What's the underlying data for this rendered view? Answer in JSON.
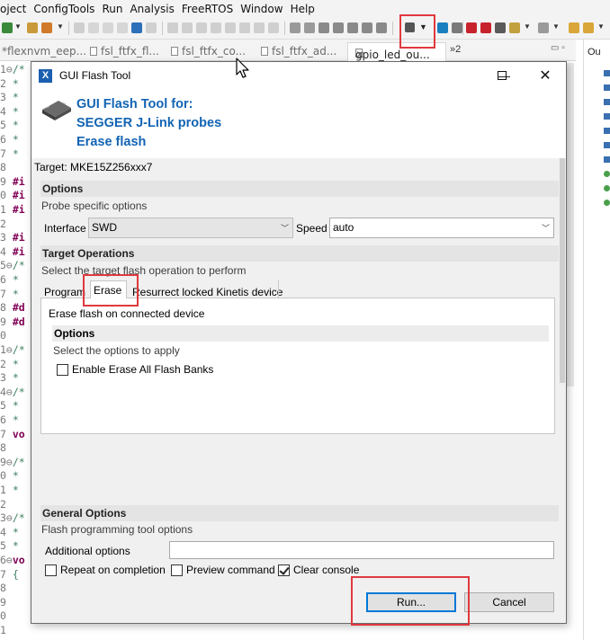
{
  "ide": {
    "menu": [
      "oject",
      "ConfigTools",
      "Run",
      "Analysis",
      "FreeRTOS",
      "Window",
      "Help"
    ],
    "editor_tabs": [
      "*flexnvm_eep...",
      "fsl_ftfx_fl...",
      "fsl_ftfx_co...",
      "fsl_ftfx_ad...",
      "gpio_led_ou..."
    ],
    "tab_close": "✕",
    "tab_overflow": "»2",
    "view_controls": "▭ ▫",
    "right_panel_tab": "Ou",
    "line_numbers": [
      "1",
      "2",
      "3",
      "4",
      "5",
      "6",
      "7",
      "8",
      "9",
      "0",
      "1",
      "2",
      "3",
      "4",
      "5",
      "6",
      "7",
      "8",
      "9",
      "0",
      "1",
      "2",
      "3",
      "4",
      "5",
      "6",
      "7",
      "8",
      "9",
      "0",
      "1",
      "2",
      "3",
      "4",
      "5",
      "6",
      "7",
      "8",
      "9",
      "0",
      "1"
    ],
    "line_snippets": [
      "/*",
      "*",
      "*",
      "*",
      "*",
      "*",
      "*",
      "",
      "#i",
      "#i",
      "#i",
      "",
      "#i",
      "#i",
      "/*",
      "*",
      "*",
      "#d",
      "#d",
      "",
      "/*",
      "*",
      "*",
      "/*",
      "*",
      "*",
      "vo",
      "",
      "/*",
      "*",
      "*",
      "",
      "/*",
      "*",
      "*",
      "vo",
      "{",
      "",
      "",
      "",
      ""
    ],
    "fold_lines": [
      0,
      14,
      20,
      23,
      28,
      32,
      35
    ]
  },
  "dialog": {
    "title": "GUI Flash Tool",
    "header_lines": [
      "GUI Flash Tool for:",
      "SEGGER J-Link probes",
      "Erase flash"
    ],
    "target": "Target: MKE15Z256xxx7",
    "options": {
      "heading": "Options",
      "subtitle": "Probe specific options",
      "interface_label": "Interface",
      "interface_value": "SWD",
      "speed_label": "Speed",
      "speed_value": "auto"
    },
    "target_ops": {
      "heading": "Target Operations",
      "subtitle": "Select the target flash operation to perform",
      "tabs": [
        "Program",
        "Erase",
        "Resurrect locked Kinetis device"
      ],
      "selected_tab": "Erase",
      "description": "Erase flash on connected device",
      "inner_heading": "Options",
      "inner_subtitle": "Select the options to apply",
      "erase_all_label": "Enable Erase All Flash Banks",
      "erase_all_checked": false
    },
    "general": {
      "heading": "General Options",
      "subtitle": "Flash programming tool options",
      "additional_label": "Additional options",
      "additional_value": "",
      "repeat_label": "Repeat on completion",
      "repeat_checked": false,
      "preview_label": "Preview command",
      "preview_checked": false,
      "clear_label": "Clear console",
      "clear_checked": true
    },
    "buttons": {
      "run": "Run...",
      "cancel": "Cancel"
    },
    "window_controls": {
      "minimize": "—",
      "maximize": "☐",
      "close": "✕"
    }
  },
  "colors": {
    "accent_blue": "#1264b4",
    "highlight_red": "#e0393e"
  }
}
